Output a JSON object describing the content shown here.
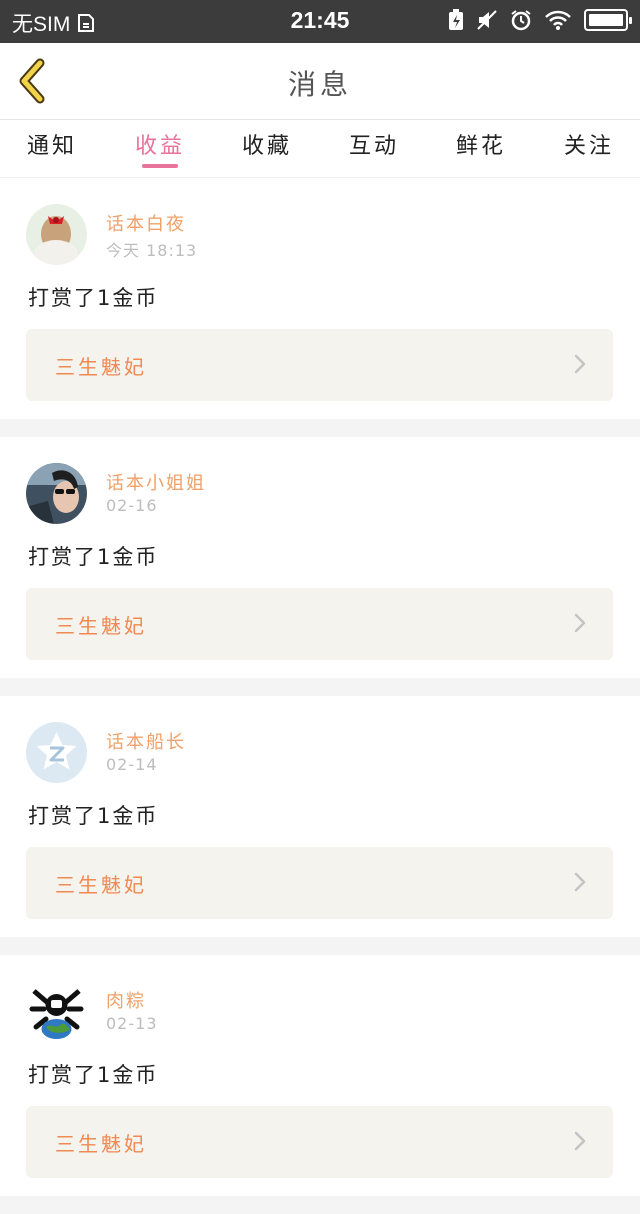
{
  "status_bar": {
    "sim": "无SIM",
    "time": "21:45"
  },
  "header": {
    "title": "消息"
  },
  "tabs": [
    {
      "label": "通知"
    },
    {
      "label": "收益"
    },
    {
      "label": "收藏"
    },
    {
      "label": "互动"
    },
    {
      "label": "鲜花"
    },
    {
      "label": "关注"
    }
  ],
  "active_tab": "收益",
  "colors": {
    "accent": "#e8739b",
    "name": "#f0a068",
    "book": "#f08a52",
    "statusbar": "#3c3c3c"
  },
  "messages": [
    {
      "user": "话本白夜",
      "time": "今天 18:13",
      "text": "打赏了1金币",
      "book": "三生魅妃",
      "avatar_icon": "girl-avatar"
    },
    {
      "user": "话本小姐姐",
      "time": "02-16",
      "text": "打赏了1金币",
      "book": "三生魅妃",
      "avatar_icon": "sunglasses-avatar"
    },
    {
      "user": "话本船长",
      "time": "02-14",
      "text": "打赏了1金币",
      "book": "三生魅妃",
      "avatar_icon": "default-z-avatar"
    },
    {
      "user": "肉粽",
      "time": "02-13",
      "text": "打赏了1金币",
      "book": "三生魅妃",
      "avatar_icon": "skull-globe-avatar"
    }
  ]
}
